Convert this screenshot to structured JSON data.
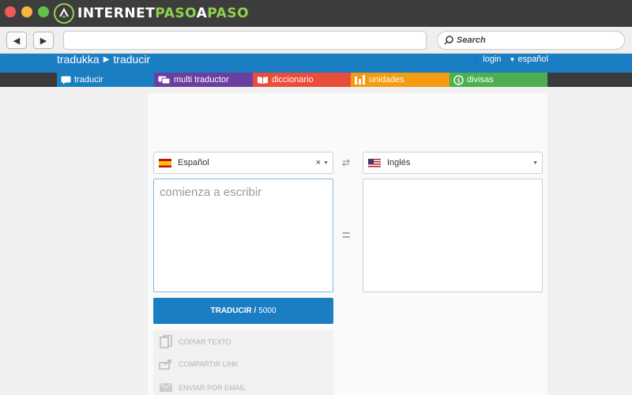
{
  "window": {
    "brand": {
      "part1": "INTERNET",
      "part2": "PASO",
      "part3": "A",
      "part4": "PASO"
    },
    "nav": {
      "back_glyph": "◀",
      "forward_glyph": "▶"
    },
    "url_value": "",
    "search_placeholder": "Search"
  },
  "site": {
    "breadcrumb": {
      "home": "tradukka",
      "current": "traducir"
    },
    "login_label": "login",
    "language_label": "español",
    "colors": {
      "primary": "#1b7dc2"
    }
  },
  "tabs": [
    {
      "label": "traducir",
      "color": "#1b7dc2",
      "icon": "chat-bubble-icon"
    },
    {
      "label": "multi traductor",
      "color": "#6b3fa0",
      "icon": "chat-bubbles-icon"
    },
    {
      "label": "diccionario",
      "color": "#e94d3c",
      "icon": "book-icon"
    },
    {
      "label": "unidades",
      "color": "#f39c12",
      "icon": "bar-chart-icon"
    },
    {
      "label": "divisas",
      "color": "#4caf50",
      "icon": "coin-icon"
    }
  ],
  "translator": {
    "source_language": "Español",
    "clear_glyph": "×",
    "target_language": "Inglés",
    "source_placeholder": "comienza a escribir",
    "source_value": "",
    "target_value": "",
    "equals_glyph": "=",
    "translate_label": "TRADUCIR /",
    "char_limit": "5000",
    "actions": [
      {
        "label": "COPIAR TEXTO",
        "icon": "copy-icon"
      },
      {
        "label": "COMPARTIR LINK",
        "icon": "share-icon"
      },
      {
        "label": "ENVIAR POR EMAIL",
        "icon": "mail-icon"
      }
    ]
  }
}
